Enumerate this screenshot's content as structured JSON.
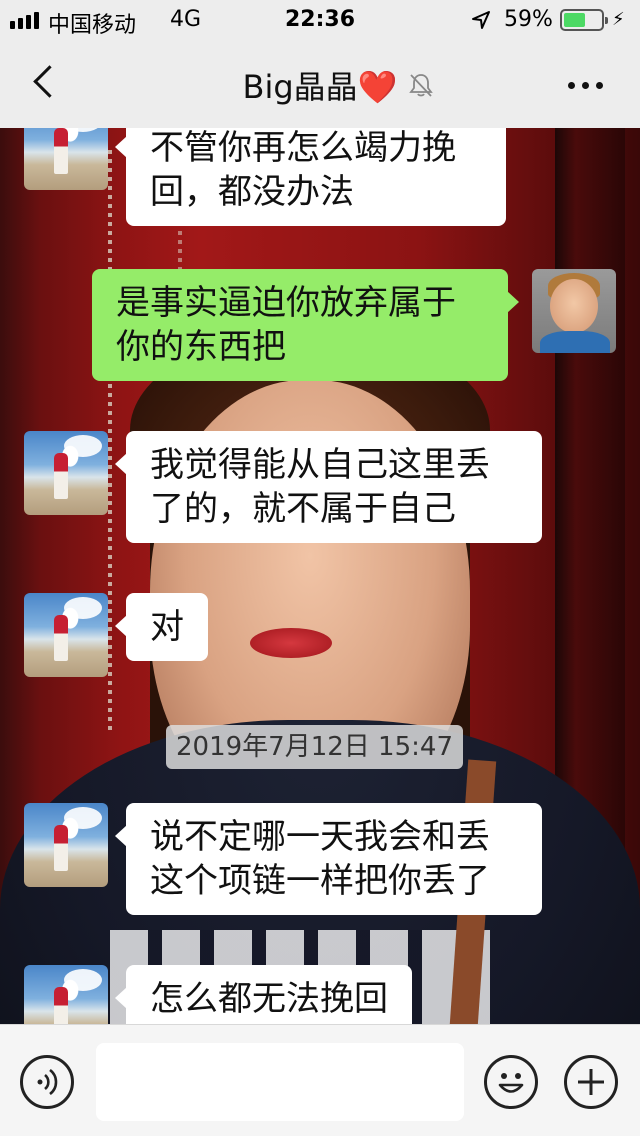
{
  "status_bar": {
    "carrier": "中国移动",
    "network": "4G",
    "time": "22:36",
    "battery_percent": "59%",
    "battery_level": 0.59,
    "icons": [
      "signal-icon",
      "location-arrow-icon",
      "battery-icon",
      "charging-bolt-icon"
    ]
  },
  "nav": {
    "title": "Big晶晶",
    "title_emoji": "❤️",
    "icons": [
      "back-chevron-icon",
      "mute-bell-icon",
      "more-dots-icon"
    ]
  },
  "messages": [
    {
      "side": "left",
      "text": "不管你再怎么竭力挽回，都没办法"
    },
    {
      "side": "right",
      "text": "是事实逼迫你放弃属于你的东西把"
    },
    {
      "side": "left",
      "text": "我觉得能从自己这里丢了的，就不属于自己"
    },
    {
      "side": "left",
      "text": "对"
    },
    {
      "side": "left",
      "text": "说不定哪一天我会和丢这个项链一样把你丢了"
    },
    {
      "side": "left",
      "text": "怎么都无法挽回"
    }
  ],
  "timestamp": "2019年7月12日 15:47",
  "input_bar": {
    "placeholder": "",
    "icons": [
      "voice-icon",
      "emoji-icon",
      "plus-icon"
    ]
  },
  "colors": {
    "sent_bubble": "#95ec69",
    "received_bubble": "#ffffff",
    "bar_bg": "#ededed"
  }
}
